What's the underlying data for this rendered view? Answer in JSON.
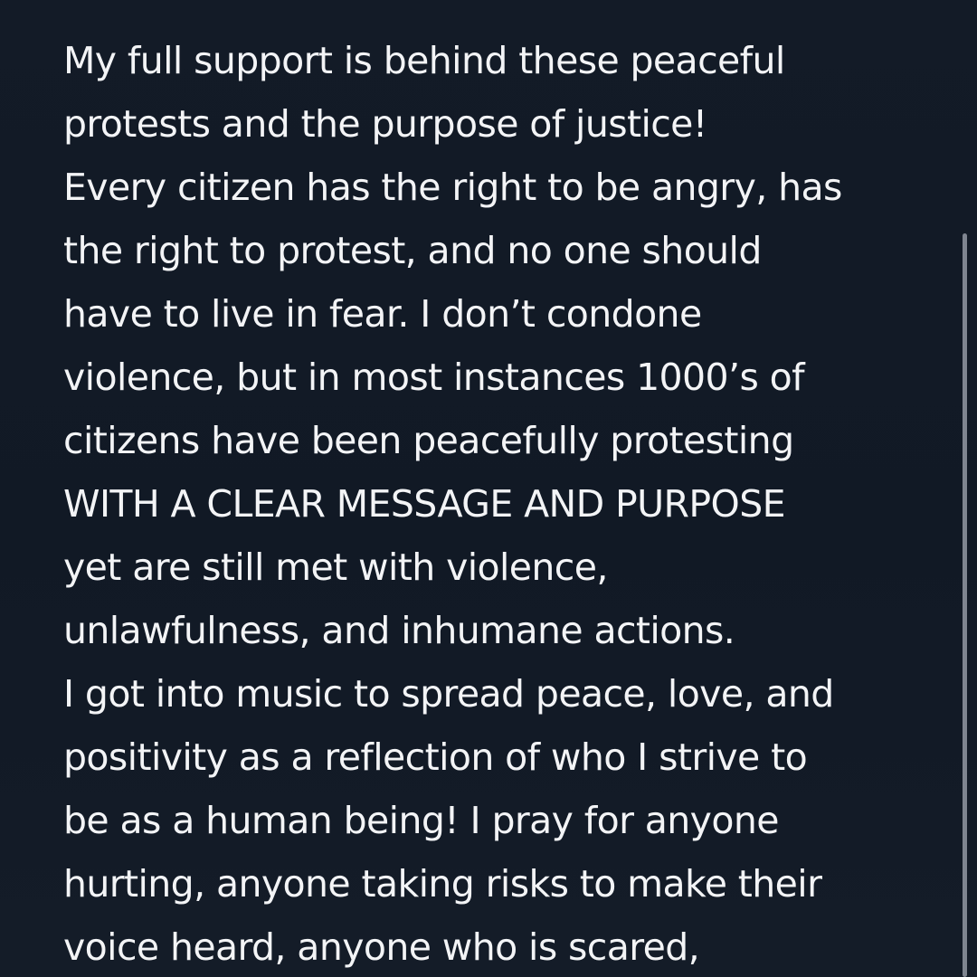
{
  "note": {
    "lines": [
      "My full support is behind these peaceful",
      "protests and the purpose of justice!",
      "Every citizen has the right to be angry, has",
      "the right to protest, and no one should",
      "have to live in fear. I don’t condone",
      "violence, but in most instances 1000’s of",
      "citizens have been peacefully protesting",
      "WITH A CLEAR MESSAGE AND PURPOSE",
      "yet are still met with violence,",
      "unlawfulness, and inhumane actions.",
      "I got into music to spread peace, love, and",
      "positivity as a reflection of who I strive to",
      "be as a human being! I pray for anyone",
      "hurting, anyone taking risks to make their",
      "voice heard, anyone who is scared,"
    ]
  },
  "colors": {
    "background": "#121a26",
    "text": "#f3f4f6",
    "scrollbar": "#7f8590"
  }
}
